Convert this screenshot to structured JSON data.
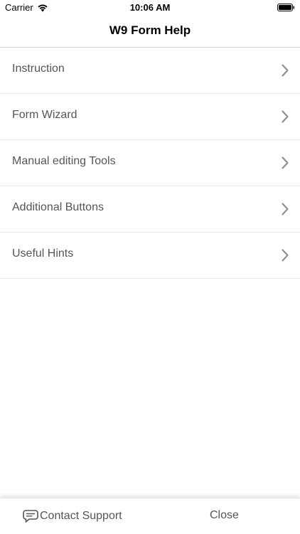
{
  "status_bar": {
    "carrier": "Carrier",
    "time": "10:06 AM"
  },
  "nav": {
    "title": "W9 Form Help"
  },
  "menu": {
    "items": [
      {
        "label": "Instruction",
        "icon": "chevron-right-icon"
      },
      {
        "label": "Form Wizard",
        "icon": "chevron-right-icon"
      },
      {
        "label": "Manual editing Tools",
        "icon": "chevron-right-icon"
      },
      {
        "label": "Additional Buttons",
        "icon": "chevron-right-icon"
      },
      {
        "label": "Useful Hints",
        "icon": "chevron-right-icon"
      }
    ]
  },
  "bottom_bar": {
    "contact_label": "Contact Support",
    "contact_icon": "chat-bubble-icon",
    "close_label": "Close"
  },
  "colors": {
    "text_gray": "#555559",
    "separator": "#ececef",
    "chevron": "#8e8e93"
  }
}
